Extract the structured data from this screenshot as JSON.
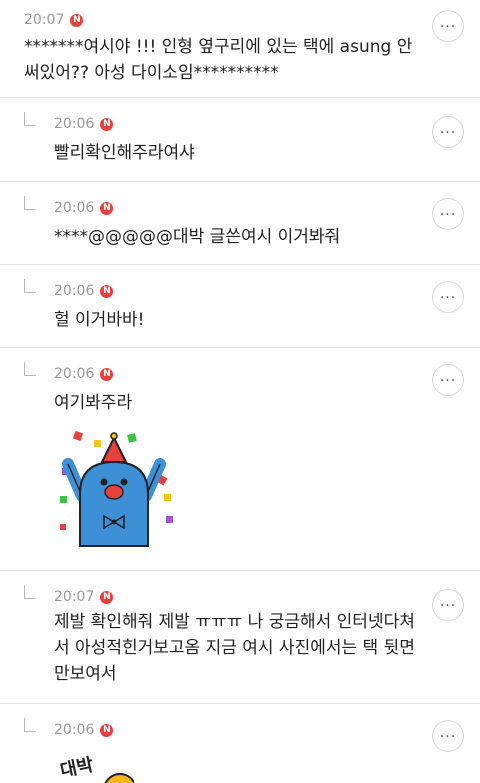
{
  "comments": [
    {
      "time": "20:07",
      "badge": "N",
      "text": "*******여시야 !!! 인형 옆구리에 있는 택에 asung 안써있어?? 아성 다이소임**********"
    },
    {
      "time": "20:06",
      "badge": "N",
      "text": "빨리확인해주라여샤"
    },
    {
      "time": "20:06",
      "badge": "N",
      "text": "****@@@@@대박 글쓴여시 이거봐줘"
    },
    {
      "time": "20:06",
      "badge": "N",
      "text": "헐 이거바바!"
    },
    {
      "time": "20:06",
      "badge": "N",
      "text": "여기봐주라",
      "sticker": "blue-party-character-sticker"
    },
    {
      "time": "20:07",
      "badge": "N",
      "text": "제발 확인해줘 제발 ㅠㅠㅠ 나 궁금해서 인터넷다쳐서 아성적힌거보고옴 지금 여시 사진에서는 택 뒷면만보여서"
    },
    {
      "time": "20:06",
      "badge": "N",
      "sticker": "daebak-sticker",
      "sticker_text": "대박"
    }
  ],
  "more_button_icon": "more-dots-icon",
  "colors": {
    "badge": "#e8413b",
    "time": "#9a9a9a",
    "divider": "#e6e6e6",
    "sticker_blue": "#3d8fd6"
  }
}
